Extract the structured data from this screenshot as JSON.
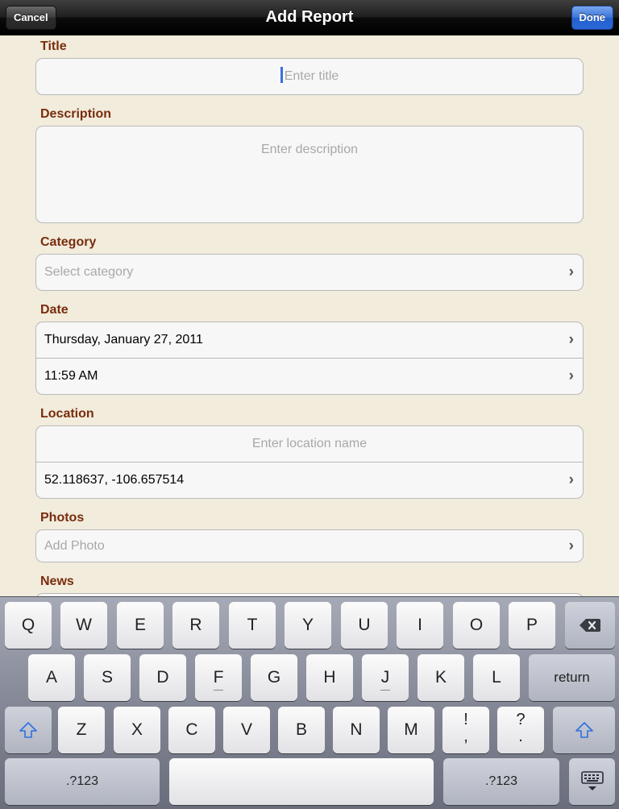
{
  "nav": {
    "title": "Add Report",
    "cancel": "Cancel",
    "done": "Done"
  },
  "form": {
    "title_label": "Title",
    "title_placeholder": "Enter title",
    "description_label": "Description",
    "description_placeholder": "Enter description",
    "category_label": "Category",
    "category_placeholder": "Select category",
    "date_label": "Date",
    "date_value": "Thursday, January 27, 2011",
    "time_value": "11:59 AM",
    "location_label": "Location",
    "location_placeholder": "Enter location name",
    "coordinates": "52.118637, -106.657514",
    "photos_label": "Photos",
    "photos_placeholder": "Add Photo",
    "news_label": "News"
  },
  "keyboard": {
    "row1": [
      "Q",
      "W",
      "E",
      "R",
      "T",
      "Y",
      "U",
      "I",
      "O",
      "P"
    ],
    "row2": [
      "A",
      "S",
      "D",
      "F",
      "G",
      "H",
      "J",
      "K",
      "L"
    ],
    "row3": [
      "Z",
      "X",
      "C",
      "V",
      "B",
      "N",
      "M"
    ],
    "punct1_top": "!",
    "punct1_bottom": ",",
    "punct2_top": "?",
    "punct2_bottom": ".",
    "return": "return",
    "numbers": ".?123",
    "icons": {
      "delete": "backspace-icon",
      "shift": "shift-icon",
      "hide": "hide-keyboard-icon"
    }
  }
}
